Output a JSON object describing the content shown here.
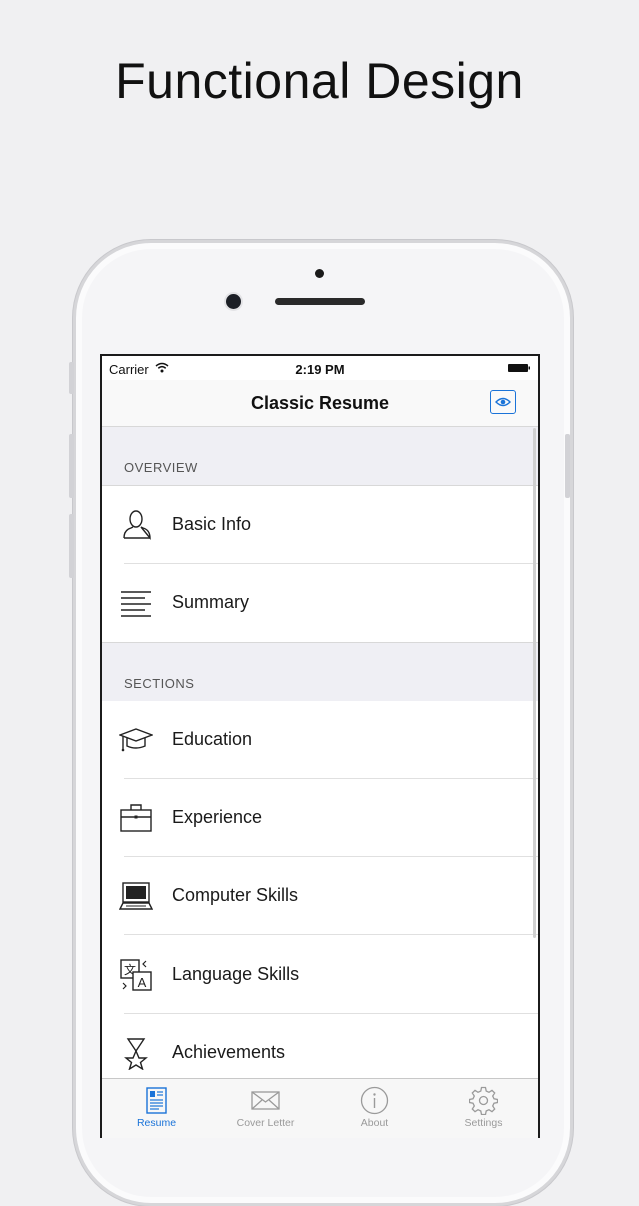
{
  "headline": "Functional Design",
  "status_bar": {
    "carrier": "Carrier",
    "time": "2:19 PM"
  },
  "nav": {
    "title": "Classic Resume",
    "preview_icon": "eye-icon"
  },
  "sections": [
    {
      "header": "OVERVIEW",
      "items": [
        {
          "label": "Basic Info",
          "icon": "person-icon"
        },
        {
          "label": "Summary",
          "icon": "text-lines-icon"
        }
      ]
    },
    {
      "header": "SECTIONS",
      "items": [
        {
          "label": "Education",
          "icon": "graduation-cap-icon"
        },
        {
          "label": "Experience",
          "icon": "briefcase-icon"
        },
        {
          "label": "Computer Skills",
          "icon": "laptop-icon"
        },
        {
          "label": "Language Skills",
          "icon": "translate-icon"
        },
        {
          "label": "Achievements",
          "icon": "trophy-icon"
        }
      ]
    }
  ],
  "tabs": [
    {
      "label": "Resume",
      "icon": "resume-icon",
      "active": true
    },
    {
      "label": "Cover Letter",
      "icon": "envelope-icon",
      "active": false
    },
    {
      "label": "About",
      "icon": "info-icon",
      "active": false
    },
    {
      "label": "Settings",
      "icon": "gear-icon",
      "active": false
    }
  ],
  "colors": {
    "accent": "#1a73d8",
    "section_bg": "#efeff4",
    "inactive_tab": "#9a9a9a"
  }
}
